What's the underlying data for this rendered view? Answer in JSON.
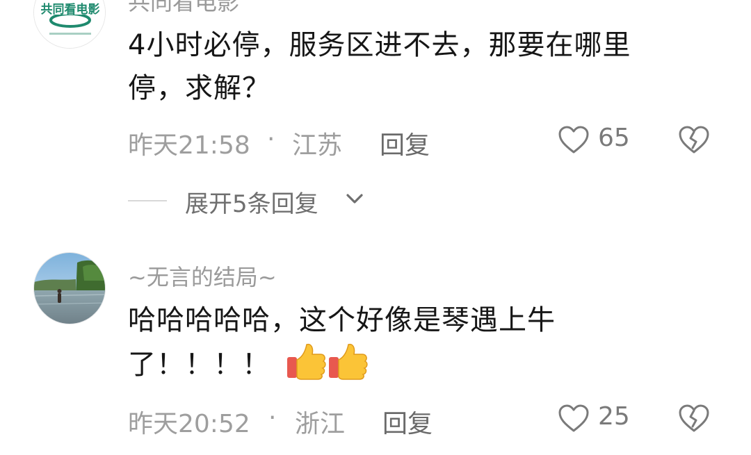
{
  "comments": [
    {
      "username": "共同看电影",
      "avatar_text": "共同看电影",
      "text_line1": "4小时必停，服务区进不去，那要在哪里",
      "text_line2": "停，求解？",
      "time": "昨天21:58",
      "separator": "·",
      "location": "江苏",
      "reply_label": "回复",
      "likes": "65"
    },
    {
      "username": "~无言的结局~",
      "text_line1": "哈哈哈哈哈，这个好像是琴遇上牛",
      "text_line2": "了！！！！",
      "time": "昨天20:52",
      "separator": "·",
      "location": "浙江",
      "reply_label": "回复",
      "likes": "25"
    }
  ],
  "expand_replies": {
    "label": "展开5条回复"
  },
  "icons": {
    "like": "heart-outline-icon",
    "dislike": "broken-heart-icon",
    "expand": "chevron-down-icon",
    "emoji": "thumbs-up-emoji"
  },
  "colors": {
    "text": "#161616",
    "meta": "#9e9e9e",
    "username": "#9a9a9a",
    "icon": "#7a7a7a",
    "logo_green": "#1f8a6e"
  }
}
